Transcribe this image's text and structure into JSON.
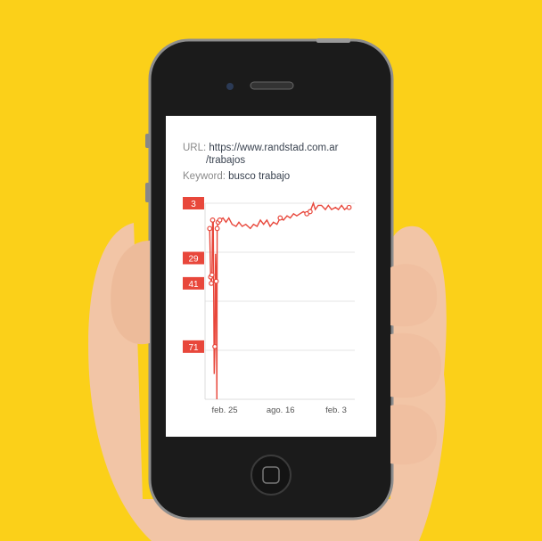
{
  "info": {
    "url_label": "URL:",
    "url_line1": "https://www.randstad.com.ar",
    "url_line2": "/trabajos",
    "keyword_label": "Keyword:",
    "keyword_value": "busco trabajo"
  },
  "colors": {
    "background": "#FBD019",
    "series": "#E8473B",
    "phone": "#1c1c1c"
  },
  "chart_data": {
    "type": "line",
    "title": "",
    "xlabel": "",
    "ylabel": "",
    "y_inverted": true,
    "ylim": [
      3,
      96
    ],
    "grid": true,
    "x_ticks": [
      {
        "date": "2017-02-25",
        "label": "feb. 25"
      },
      {
        "date": "2017-08-16",
        "label": "ago. 16"
      },
      {
        "date": "2018-02-03",
        "label": "feb. 3"
      }
    ],
    "y_labels": [
      "3",
      "29",
      "41",
      "71"
    ],
    "series": [
      {
        "points": [
          {
            "x": "2017-01-10",
            "y": 15,
            "m": 1
          },
          {
            "x": "2017-01-13",
            "y": 38,
            "m": 1
          },
          {
            "x": "2017-01-15",
            "y": 41,
            "m": 1
          },
          {
            "x": "2017-01-17",
            "y": 37,
            "m": 1
          },
          {
            "x": "2017-01-19",
            "y": 11,
            "m": 1
          },
          {
            "x": "2017-01-21",
            "y": 11
          },
          {
            "x": "2017-01-24",
            "y": 84
          },
          {
            "x": "2017-01-26",
            "y": 71,
            "m": 1
          },
          {
            "x": "2017-01-28",
            "y": 27
          },
          {
            "x": "2017-01-30",
            "y": 40,
            "m": 1
          },
          {
            "x": "2017-02-01",
            "y": 96
          },
          {
            "x": "2017-02-02",
            "y": 15,
            "m": 1
          },
          {
            "x": "2017-02-05",
            "y": 12,
            "m": 1
          },
          {
            "x": "2017-02-10",
            "y": 11,
            "m": 1
          },
          {
            "x": "2017-02-20",
            "y": 10
          },
          {
            "x": "2017-03-01",
            "y": 12
          },
          {
            "x": "2017-03-10",
            "y": 10
          },
          {
            "x": "2017-03-20",
            "y": 13
          },
          {
            "x": "2017-04-01",
            "y": 14
          },
          {
            "x": "2017-04-10",
            "y": 12
          },
          {
            "x": "2017-04-20",
            "y": 14
          },
          {
            "x": "2017-05-01",
            "y": 13
          },
          {
            "x": "2017-05-15",
            "y": 15
          },
          {
            "x": "2017-05-25",
            "y": 13
          },
          {
            "x": "2017-06-05",
            "y": 14
          },
          {
            "x": "2017-06-15",
            "y": 11
          },
          {
            "x": "2017-06-25",
            "y": 13
          },
          {
            "x": "2017-07-05",
            "y": 11
          },
          {
            "x": "2017-07-15",
            "y": 14
          },
          {
            "x": "2017-07-25",
            "y": 12
          },
          {
            "x": "2017-08-05",
            "y": 13
          },
          {
            "x": "2017-08-15",
            "y": 10,
            "m": 1
          },
          {
            "x": "2017-08-25",
            "y": 11
          },
          {
            "x": "2017-09-05",
            "y": 9
          },
          {
            "x": "2017-09-15",
            "y": 10
          },
          {
            "x": "2017-09-25",
            "y": 8
          },
          {
            "x": "2017-10-05",
            "y": 9
          },
          {
            "x": "2017-10-15",
            "y": 8
          },
          {
            "x": "2017-10-25",
            "y": 7
          },
          {
            "x": "2017-11-05",
            "y": 8,
            "m": 1
          },
          {
            "x": "2017-11-15",
            "y": 7,
            "m": 1
          },
          {
            "x": "2017-11-25",
            "y": 3
          },
          {
            "x": "2017-12-01",
            "y": 6
          },
          {
            "x": "2017-12-10",
            "y": 4
          },
          {
            "x": "2017-12-20",
            "y": 4
          },
          {
            "x": "2018-01-01",
            "y": 6
          },
          {
            "x": "2018-01-10",
            "y": 4
          },
          {
            "x": "2018-01-20",
            "y": 6
          },
          {
            "x": "2018-02-01",
            "y": 5
          },
          {
            "x": "2018-02-10",
            "y": 6
          },
          {
            "x": "2018-02-20",
            "y": 4
          },
          {
            "x": "2018-03-01",
            "y": 6
          },
          {
            "x": "2018-03-10",
            "y": 5
          },
          {
            "x": "2018-03-15",
            "y": 5,
            "m": 1
          }
        ]
      }
    ]
  }
}
